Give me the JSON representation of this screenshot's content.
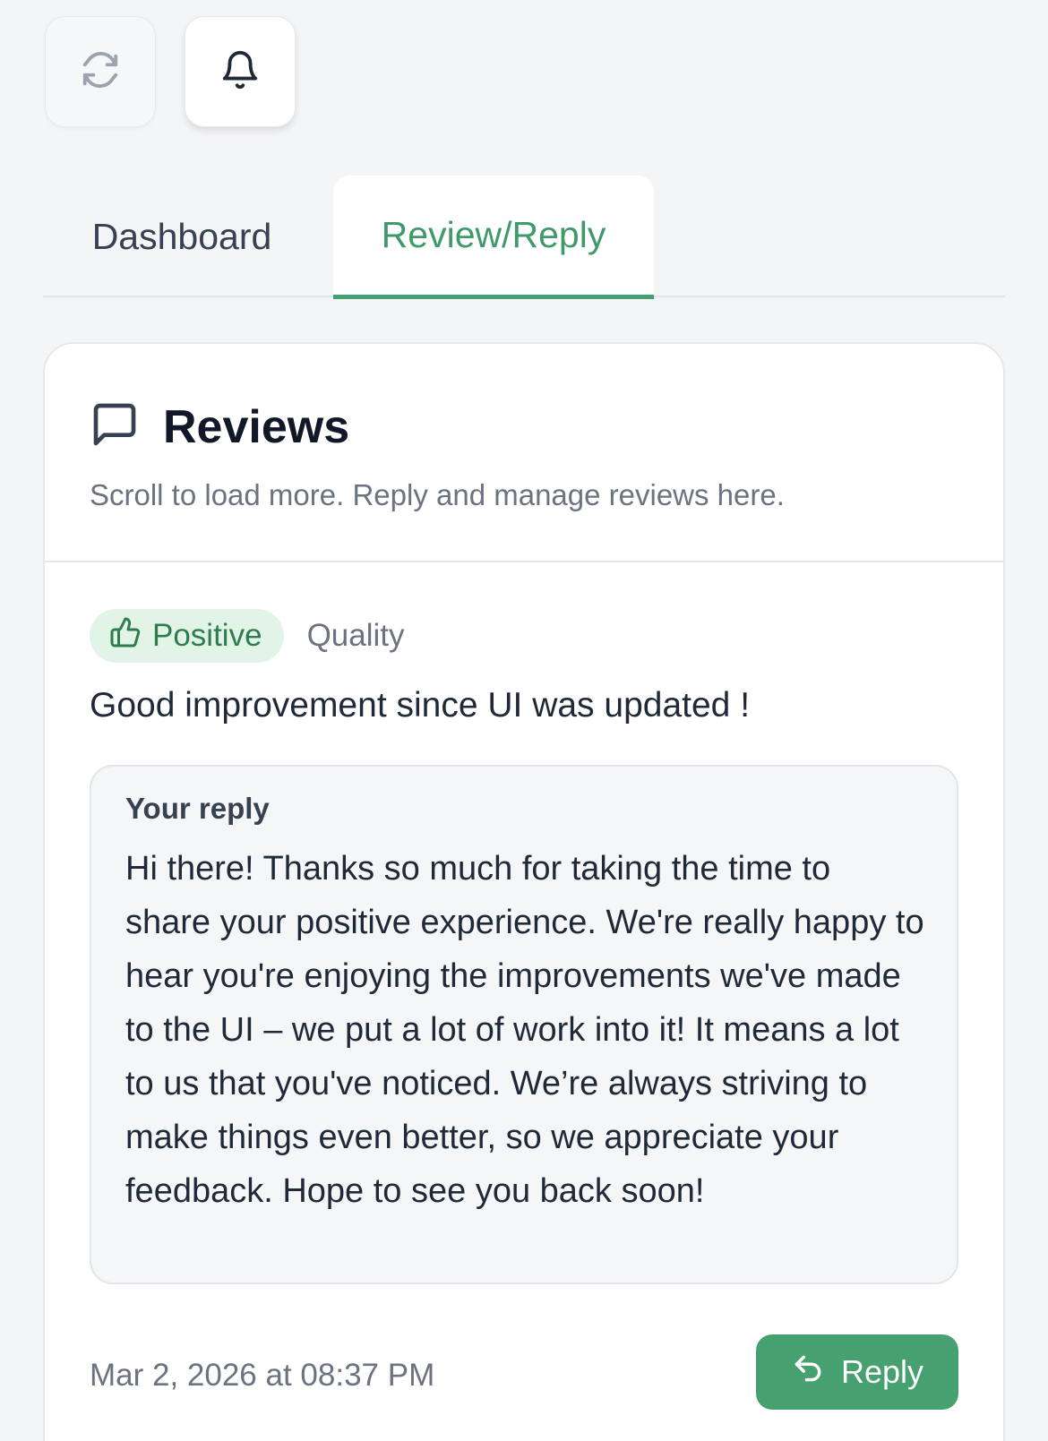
{
  "toolbar": {
    "refresh_icon": "refresh-icon",
    "bell_icon": "bell-icon"
  },
  "tabs": [
    {
      "label": "Dashboard",
      "active": false
    },
    {
      "label": "Review/Reply",
      "active": true
    }
  ],
  "reviews_card": {
    "title": "Reviews",
    "title_icon": "message-square-icon",
    "subtitle": "Scroll to load more. Reply and manage reviews here."
  },
  "review": {
    "sentiment": "Positive",
    "sentiment_icon": "thumbs-up-icon",
    "category": "Quality",
    "text": "Good improvement since UI was updated !",
    "reply": {
      "heading": "Your reply",
      "text": "Hi there! Thanks so much for taking the time to share your positive experience. We're really happy to hear you're enjoying the improvements we've made to the UI – we put a lot of work into it! It means a lot to us that you've noticed. We’re always striving to make things even better, so we appreciate your feedback. Hope to see you back soon!"
    },
    "date": "Mar 2, 2026 at 08:37 PM",
    "reply_button_label": "Reply",
    "reply_button_icon": "reply-arrow-icon"
  },
  "colors": {
    "accent": "#46a06f",
    "badge_bg": "#e2f4e7",
    "page_bg": "#f4f5f7"
  }
}
